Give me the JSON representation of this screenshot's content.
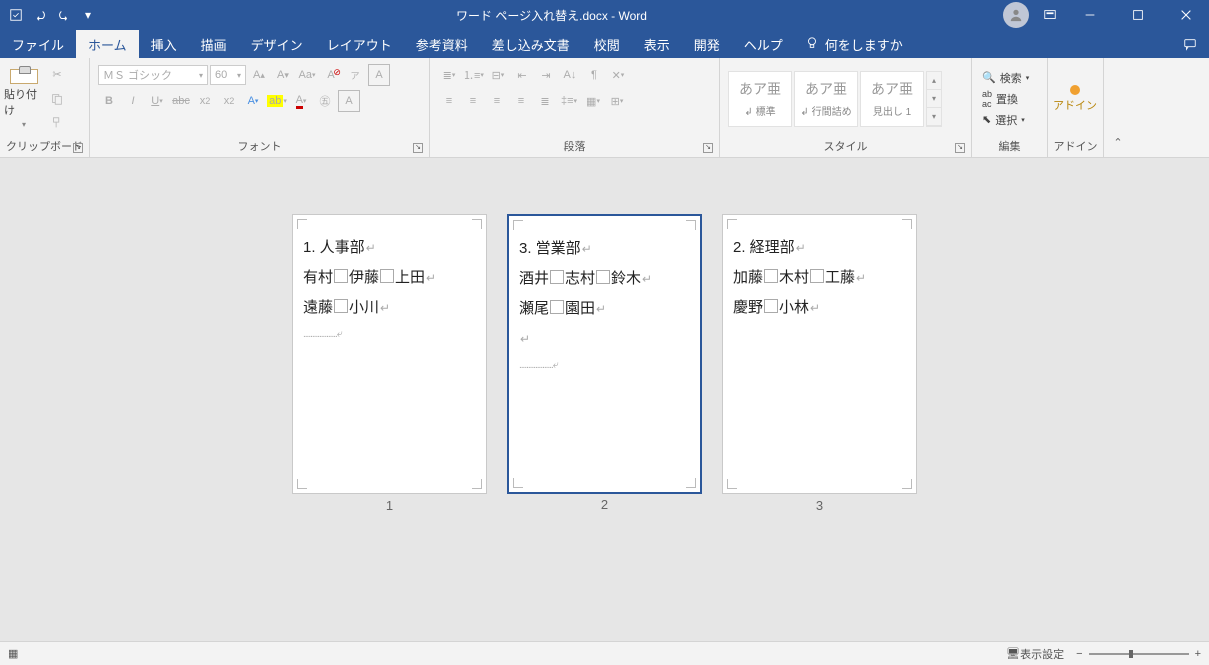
{
  "title": "ワード ページ入れ替え.docx - Word",
  "qat": {
    "save": "save-icon",
    "undo": "undo-icon",
    "redo": "redo-icon"
  },
  "tabs": [
    "ファイル",
    "ホーム",
    "挿入",
    "描画",
    "デザイン",
    "レイアウト",
    "参考資料",
    "差し込み文書",
    "校閲",
    "表示",
    "開発",
    "ヘルプ"
  ],
  "activeTab": 1,
  "tellme": "何をしますか",
  "ribbon": {
    "clipboard": {
      "label": "クリップボード",
      "paste": "貼り付け"
    },
    "font": {
      "label": "フォント",
      "name": "ＭＳ ゴシック",
      "size": "60"
    },
    "paragraph": {
      "label": "段落"
    },
    "styles": {
      "label": "スタイル",
      "items": [
        {
          "preview": "あア亜",
          "name": "↲ 標準"
        },
        {
          "preview": "あア亜",
          "name": "↲ 行間詰め"
        },
        {
          "preview": "あア亜",
          "name": "見出し 1"
        }
      ]
    },
    "editing": {
      "label": "編集",
      "find": "検索",
      "replace": "置換",
      "select": "選択"
    },
    "addin": {
      "label": "アドイン",
      "text": "アドイン"
    }
  },
  "pages": [
    {
      "num": "1",
      "selected": false,
      "lines": [
        "1. 人事部",
        "有村□伊藤□上田",
        "遠藤□小川"
      ],
      "trail": "dots"
    },
    {
      "num": "2",
      "selected": true,
      "lines": [
        "3. 営業部",
        "酒井□志村□鈴木",
        "瀬尾□園田",
        ""
      ],
      "trail": "dots"
    },
    {
      "num": "3",
      "selected": false,
      "lines": [
        "2. 経理部",
        "加藤□木村□工藤",
        "慶野□小林"
      ],
      "trail": "none"
    }
  ],
  "status": {
    "display": "表示設定"
  }
}
